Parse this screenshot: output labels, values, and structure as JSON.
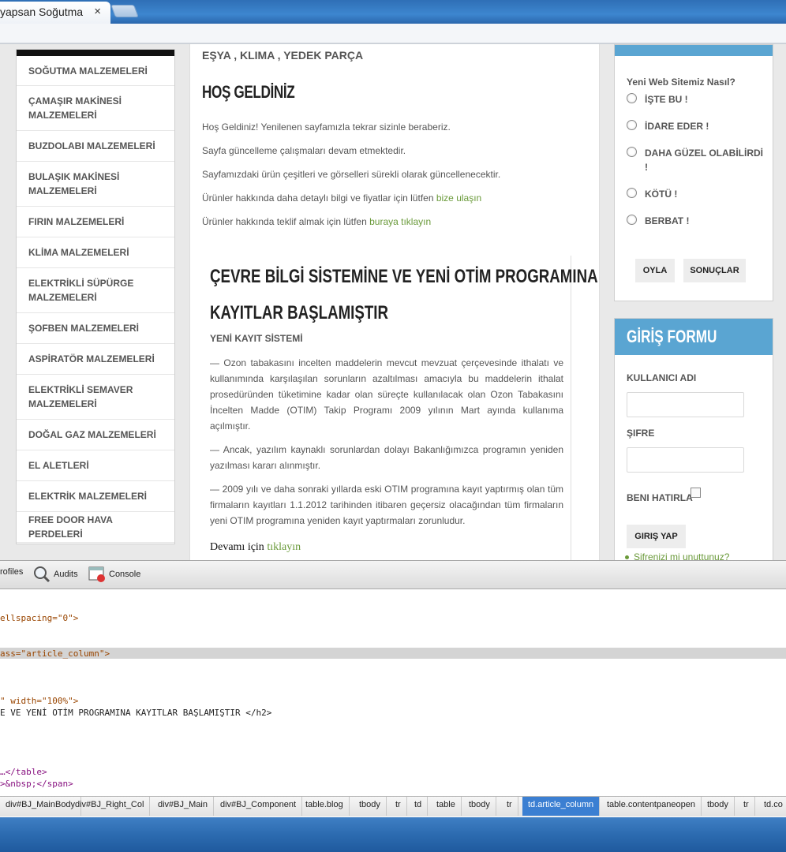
{
  "browser": {
    "tab_title": "yapsan Soğutma",
    "tab_close": "×"
  },
  "page": {
    "subheader": "EŞYA , KLIMA , YEDEK PARÇA",
    "welcome_title": "HOŞ GELDİNİZ",
    "welcome_lines": [
      "Hoş Geldiniz! Yenilenen sayfamızla tekrar sizinle beraberiz.",
      "Sayfa güncelleme çalışmaları devam etmektedir.",
      "Sayfamızdaki ürün çeşitleri ve görselleri sürekli olarak güncellenecektir."
    ],
    "contact_line": "Ürünler hakkında daha detaylı bilgi ve fiyatlar için lütfen",
    "contact_link": "bize ulaşın",
    "offer_line": "Ürünler hakkında teklif almak için lütfen",
    "offer_link": "buraya tıklayın"
  },
  "sidebar": {
    "items": [
      "SOĞUTMA MALZEMELERİ",
      "ÇAMAŞIR MAKİNESİ MALZEMELERİ",
      "BUZDOLABI MALZEMELERİ",
      "BULAŞIK MAKİNESİ MALZEMELERİ",
      "FIRIN MALZEMELERİ",
      "KLİMA MALZEMELERİ",
      "ELEKTRİKLİ SÜPÜRGE MALZEMELERİ",
      "ŞOFBEN MALZEMELERİ",
      "ASPİRATÖR MALZEMELERİ",
      "ELEKTRİKLİ SEMAVER MALZEMELERİ",
      "DOĞAL GAZ MALZEMELERİ",
      "EL ALETLERİ",
      "ELEKTRİK MALZEMELERİ",
      "FREE DOOR HAVA PERDELERİ"
    ]
  },
  "article": {
    "title_line1": "ÇEVRE BİLGİ SİSTEMİNE VE YENİ OTİM PROGRAMINA",
    "title_line2": "KAYITLAR BAŞLAMIŞTIR",
    "subtitle": "YENİ KAYIT SİSTEMİ",
    "p1": "— Ozon tabakasını incelten maddelerin mevcut mevzuat çerçevesinde ithalatı ve kullanımında karşılaşılan sorunların azaltılması amacıyla bu maddelerin ithalat prosedüründen tüketimine kadar olan süreçte kullanılacak olan Ozon Tabakasını İncelten Madde (OTIM) Takip Programı 2009 yılının Mart ayında kullanıma açılmıştır.",
    "p2": "— Ancak, yazılım kaynaklı sorunlardan dolayı Bakanlığımızca programın yeniden yazılması kararı alınmıştır.",
    "p3": "— 2009 yılı ve daha sonraki yıllarda eski OTIM programına kayıt yaptırmış olan tüm firmaların kayıtları 1.1.2012 tarihinden itibaren geçersiz olacağından tüm firmaların yeni OTIM programına yeniden kayıt yaptırmaları zorunludur.",
    "more_text": "Devamı için",
    "more_link": "tıklayın"
  },
  "poll": {
    "question": "Yeni Web Sitemiz Nasıl?",
    "options": [
      "İŞTE BU !",
      "İDARE EDER !",
      "DAHA GÜZEL OLABİLİRDİ !",
      "KÖTÜ !",
      "BERBAT !"
    ],
    "vote_label": "OYLA",
    "results_label": "SONUÇLAR"
  },
  "login": {
    "title": "GİRİŞ FORMU",
    "username_label": "KULLANICI ADI",
    "password_label": "ŞIFRE",
    "remember_label": "BENI HATIRLA",
    "submit_label": "GIRIŞ YAP",
    "forgot_link": "Şifrenizi mi unuttunuz?"
  },
  "devtools": {
    "tabs": [
      "rofiles",
      "Audits",
      "Console"
    ],
    "code_lines": [
      [
        "ellspacing=\"0\">",
        ""
      ],
      [
        "ass=\"article_column\">",
        ""
      ],
      [
        "\" width=\"100%\">",
        ""
      ],
      [
        "E VE YENİ OTİM PROGRAMINA KAYITLAR BAŞLAMIŞTIR </h2>",
        ""
      ],
      [
        "…</table>",
        ""
      ],
      [
        ">&nbsp;</span>",
        ""
      ]
    ],
    "breadcrumbs": [
      "div#BJ_MainBody",
      "div#BJ_Right_Col",
      "div#BJ_Main",
      "div#BJ_Component",
      "table.blog",
      "tbody",
      "tr",
      "td",
      "table",
      "tbody",
      "tr",
      "td.article_column",
      "table.contentpaneopen",
      "tbody",
      "tr",
      "td.co"
    ],
    "selected_crumb": "td.article_column"
  },
  "colors": {
    "accent_blue": "#5aa5d2",
    "link_green": "#6a9a3a",
    "selected_crumb": "#3b7fd2"
  }
}
